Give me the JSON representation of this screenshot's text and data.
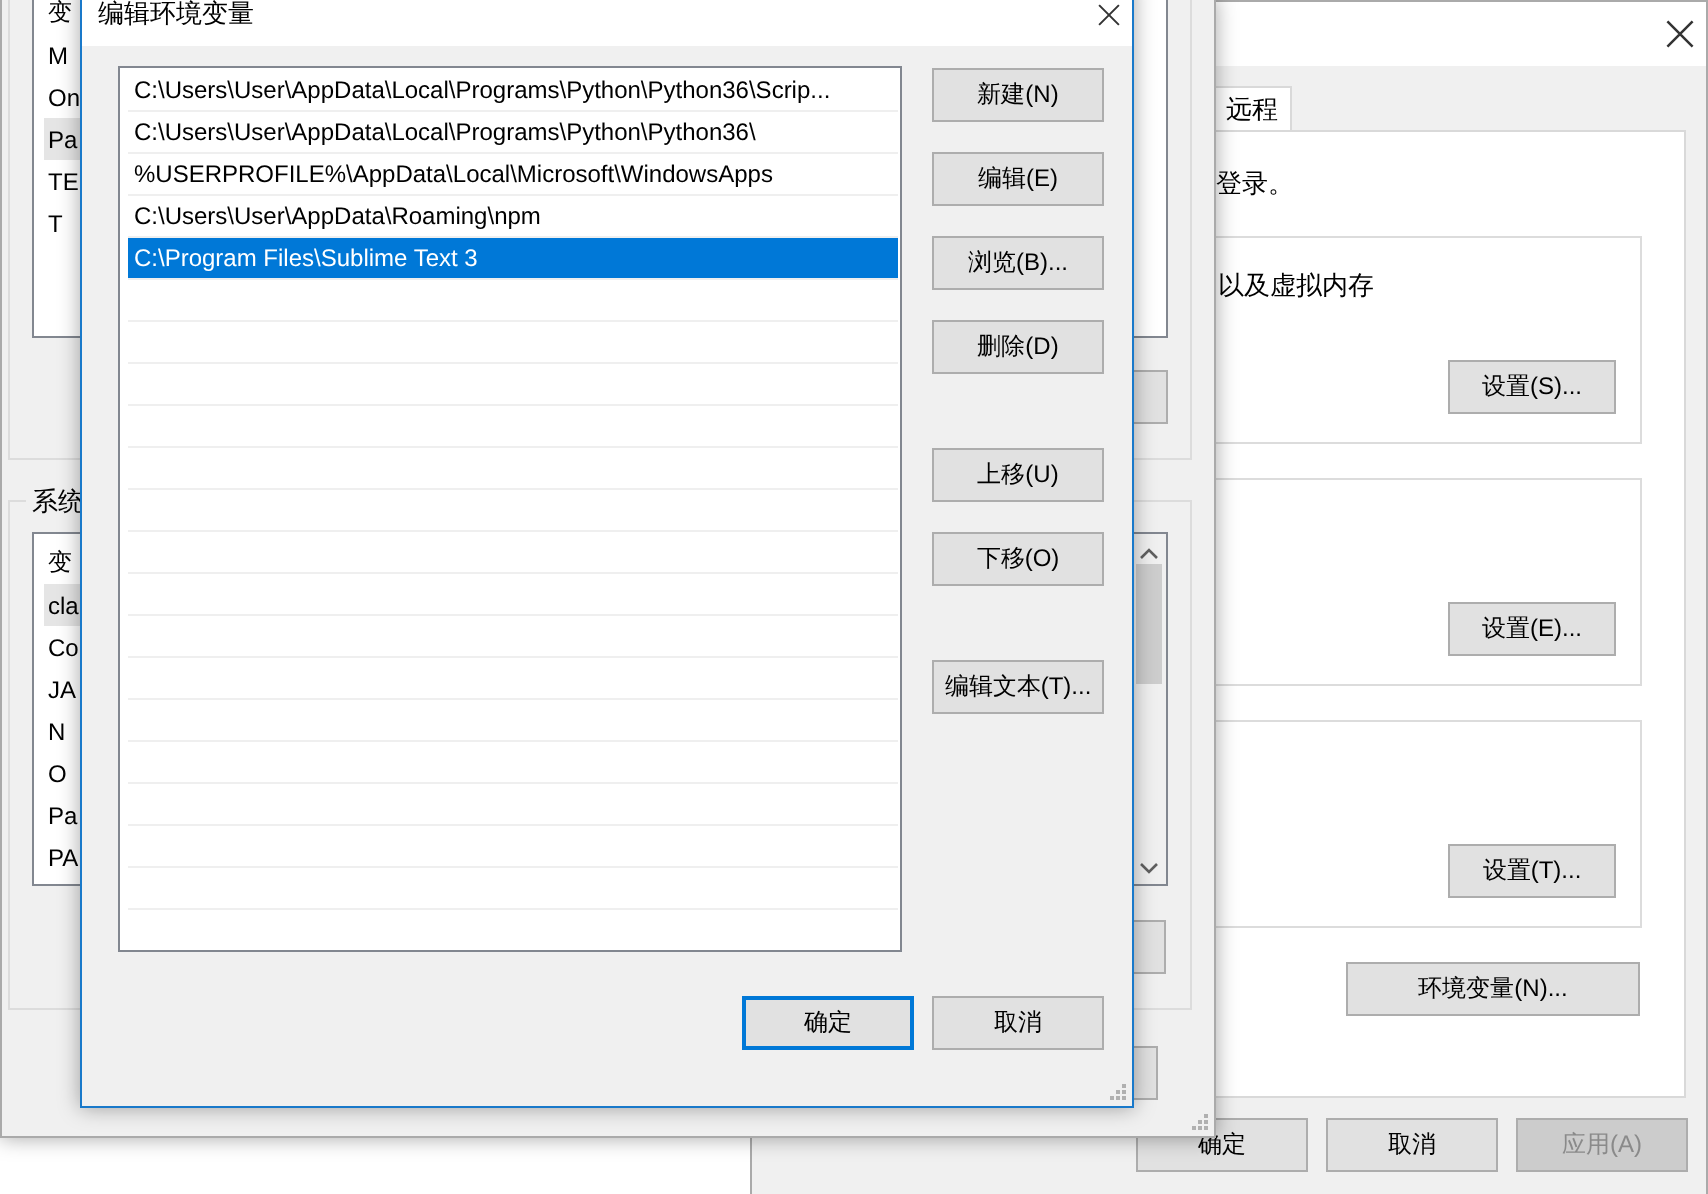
{
  "properties_window": {
    "tab": {
      "label": "远程",
      "selected": true
    },
    "intro": "登录。",
    "groups": [
      {
        "text": "以及虚拟内存",
        "button": "设置(S)..."
      },
      {
        "button": "设置(E)..."
      },
      {
        "button": "设置(T)..."
      }
    ],
    "env_button": "环境变量(N)...",
    "buttons": [
      {
        "label": "确定",
        "disabled": false
      },
      {
        "label": "取消",
        "disabled": false
      },
      {
        "label": "应用(A)",
        "disabled": true
      }
    ]
  },
  "env_window": {
    "user_vars_header": "变",
    "user_vars": [
      {
        "name": "M",
        "selected": false
      },
      {
        "name": "On",
        "selected": false
      },
      {
        "name": "Pa",
        "selected": true
      },
      {
        "name": "TE",
        "selected": false
      },
      {
        "name": "T",
        "selected": false
      }
    ],
    "system_group_label": "系统",
    "system_vars_header": "变",
    "system_vars": [
      {
        "name": "cla",
        "selected": true
      },
      {
        "name": "Co",
        "selected": false
      },
      {
        "name": "JA",
        "selected": false
      },
      {
        "name": "N",
        "selected": false
      },
      {
        "name": "O",
        "selected": false
      },
      {
        "name": "Pa",
        "selected": false
      },
      {
        "name": "PA",
        "selected": false
      }
    ]
  },
  "edit_dialog": {
    "title": "编辑环境变量",
    "paths": [
      {
        "text": "C:\\Users\\User\\AppData\\Local\\Programs\\Python\\Python36\\Scrip...",
        "selected": false
      },
      {
        "text": "C:\\Users\\User\\AppData\\Local\\Programs\\Python\\Python36\\",
        "selected": false
      },
      {
        "text": "%USERPROFILE%\\AppData\\Local\\Microsoft\\WindowsApps",
        "selected": false
      },
      {
        "text": "C:\\Users\\User\\AppData\\Roaming\\npm",
        "selected": false
      },
      {
        "text": "C:\\Program Files\\Sublime Text 3",
        "selected": true
      }
    ],
    "side_button_groups": [
      [
        "新建(N)",
        "编辑(E)",
        "浏览(B)...",
        "删除(D)"
      ],
      [
        "上移(U)",
        "下移(O)"
      ],
      [
        "编辑文本(T)..."
      ]
    ],
    "footer_buttons": [
      {
        "label": "确定",
        "focused": true
      },
      {
        "label": "取消",
        "focused": false
      }
    ]
  }
}
